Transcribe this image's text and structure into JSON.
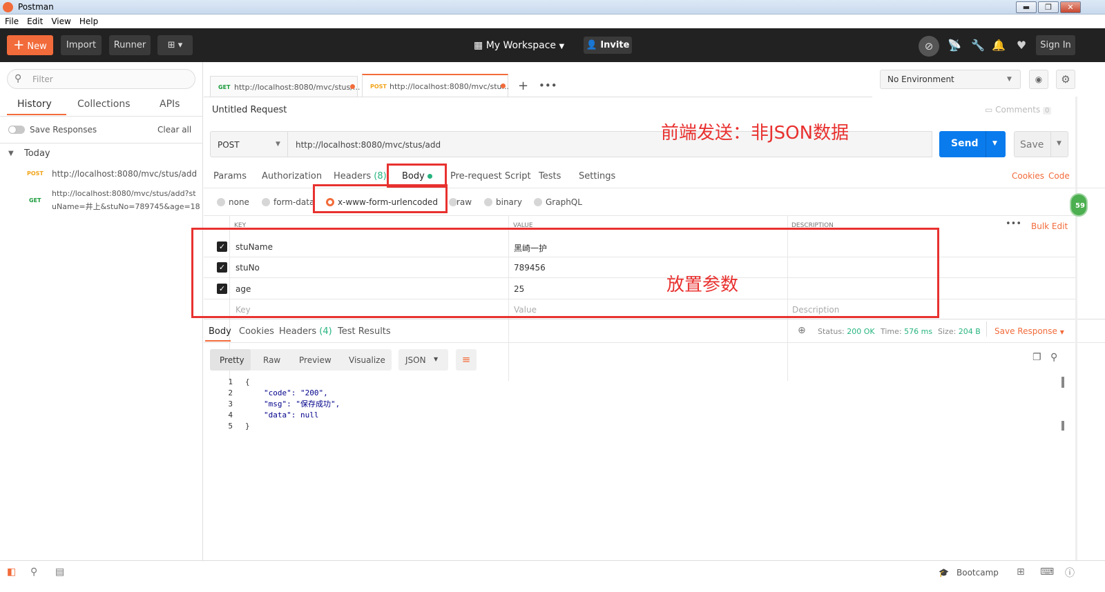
{
  "window": {
    "title": "Postman",
    "minimize": "▬",
    "maximize": "❐",
    "close": "✕"
  },
  "menu": [
    "File",
    "Edit",
    "View",
    "Help"
  ],
  "toolbar": {
    "new_label": "New",
    "import_label": "Import",
    "runner_label": "Runner",
    "workspace_label": "My Workspace",
    "invite_label": "Invite",
    "signin_label": "Sign In",
    "icons": [
      "sync-off-icon",
      "satellite-icon",
      "wrench-icon",
      "bell-icon",
      "heart-icon"
    ]
  },
  "sidebar": {
    "filter_placeholder": "Filter",
    "tabs": [
      "History",
      "Collections",
      "APIs"
    ],
    "save_responses_label": "Save Responses",
    "clear_all_label": "Clear all",
    "group_label": "Today",
    "history": [
      {
        "method": "POST",
        "url": "http://localhost:8080/mvc/stus/add"
      },
      {
        "method": "GET",
        "url": "http://localhost:8080/mvc/stus/add?stuName=井上&stuNo=789745&age=18",
        "line1": "http://localhost:8080/mvc/stus/add?st",
        "line2": "uName=井上&stuNo=789745&age=18"
      }
    ]
  },
  "request_tabs": [
    {
      "method": "GET",
      "url": "http://localhost:8080/mvc/stus/..."
    },
    {
      "method": "POST",
      "url": "http://localhost:8080/mvc/stu..."
    }
  ],
  "environment": {
    "selected": "No Environment"
  },
  "request": {
    "title": "Untitled Request",
    "comments_label": "Comments",
    "comments_count": "0",
    "method": "POST",
    "url": "http://localhost:8080/mvc/stus/add",
    "send_label": "Send",
    "save_label": "Save",
    "subtabs": {
      "params": "Params",
      "authorization": "Authorization",
      "headers": "Headers",
      "headers_count": "(8)",
      "body": "Body",
      "prerequest": "Pre-request Script",
      "tests": "Tests",
      "settings": "Settings"
    },
    "cookies_label": "Cookies",
    "code_label": "Code",
    "body_types": {
      "none": "none",
      "formdata": "form-data",
      "urlencoded": "x-www-form-urlencoded",
      "raw": "raw",
      "binary": "binary",
      "graphql": "GraphQL"
    },
    "table": {
      "headers": {
        "key": "KEY",
        "value": "VALUE",
        "description": "DESCRIPTION"
      },
      "bulk_edit_label": "Bulk Edit",
      "rows": [
        {
          "key": "stuName",
          "value": "黑崎一护",
          "description": ""
        },
        {
          "key": "stuNo",
          "value": "789456",
          "description": ""
        },
        {
          "key": "age",
          "value": "25",
          "description": ""
        }
      ],
      "placeholder": {
        "key": "Key",
        "value": "Value",
        "description": "Description"
      }
    }
  },
  "annotations": {
    "front_end": "前端发送：非JSON数据",
    "params": "放置参数"
  },
  "response": {
    "tabs": {
      "body": "Body",
      "cookies": "Cookies",
      "headers": "Headers",
      "headers_count": "(4)",
      "test_results": "Test Results"
    },
    "status_label": "Status:",
    "status_value": "200 OK",
    "time_label": "Time:",
    "time_value": "576 ms",
    "size_label": "Size:",
    "size_value": "204 B",
    "save_response_label": "Save Response",
    "views": {
      "pretty": "Pretty",
      "raw": "Raw",
      "preview": "Preview",
      "visualize": "Visualize"
    },
    "format": "JSON",
    "lines": [
      "1",
      "2",
      "3",
      "4",
      "5"
    ],
    "code": [
      "{",
      "\"code\": \"200\",",
      "\"msg\": \"保存成功\",",
      "\"data\": null",
      "}"
    ]
  },
  "side_badge": "59",
  "footer": {
    "bootcamp_label": "Bootcamp"
  },
  "colors": {
    "accent": "#f26b3a",
    "send": "#097bed",
    "status_ok": "#26b47f",
    "annotation": "#e8312f"
  }
}
